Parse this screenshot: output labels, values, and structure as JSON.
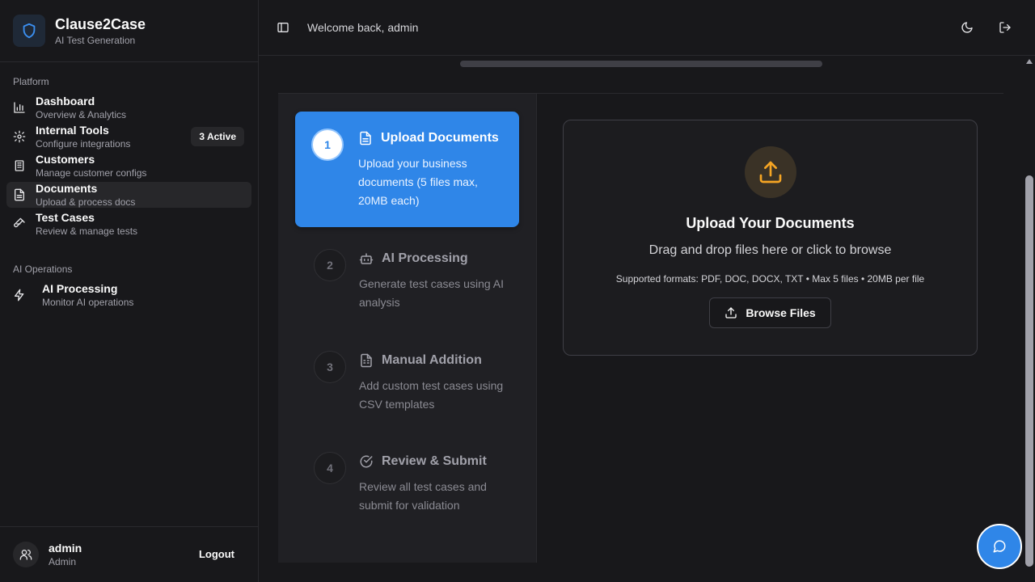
{
  "brand": {
    "title": "Clause2Case",
    "subtitle": "AI Test Generation"
  },
  "sidebar": {
    "sections": [
      {
        "label": "Platform"
      },
      {
        "label": "AI Operations"
      }
    ],
    "items": [
      {
        "title": "Dashboard",
        "subtitle": "Overview & Analytics",
        "icon": "chart-icon"
      },
      {
        "title": "Internal Tools",
        "subtitle": "Configure integrations",
        "icon": "gear-icon",
        "badge": "3 Active"
      },
      {
        "title": "Customers",
        "subtitle": "Manage customer configs",
        "icon": "building-icon"
      },
      {
        "title": "Documents",
        "subtitle": "Upload & process docs",
        "icon": "document-icon",
        "active": true
      },
      {
        "title": "Test Cases",
        "subtitle": "Review & manage tests",
        "icon": "test-tube-icon"
      },
      {
        "title": "AI Processing",
        "subtitle": "Monitor AI operations",
        "icon": "lightning-icon"
      }
    ],
    "user": {
      "name": "admin",
      "role": "Admin",
      "logout_label": "Logout"
    }
  },
  "header": {
    "welcome": "Welcome back, admin"
  },
  "steps": [
    {
      "number": "1",
      "title": "Upload Documents",
      "description": "Upload your business documents (5 files max, 20MB each)",
      "active": true
    },
    {
      "number": "2",
      "title": "AI Processing",
      "description": "Generate test cases using AI analysis"
    },
    {
      "number": "3",
      "title": "Manual Addition",
      "description": "Add custom test cases using CSV templates"
    },
    {
      "number": "4",
      "title": "Review & Submit",
      "description": "Review all test cases and submit for validation"
    }
  ],
  "upload": {
    "title": "Upload Your Documents",
    "subtitle": "Drag and drop files here or click to browse",
    "formats": "Supported formats: PDF, DOC, DOCX, TXT • Max 5 files • 20MB per file",
    "button_label": "Browse Files"
  },
  "colors": {
    "accent": "#2f86e8",
    "upload_icon": "#f5a524",
    "background": "#18181b"
  }
}
